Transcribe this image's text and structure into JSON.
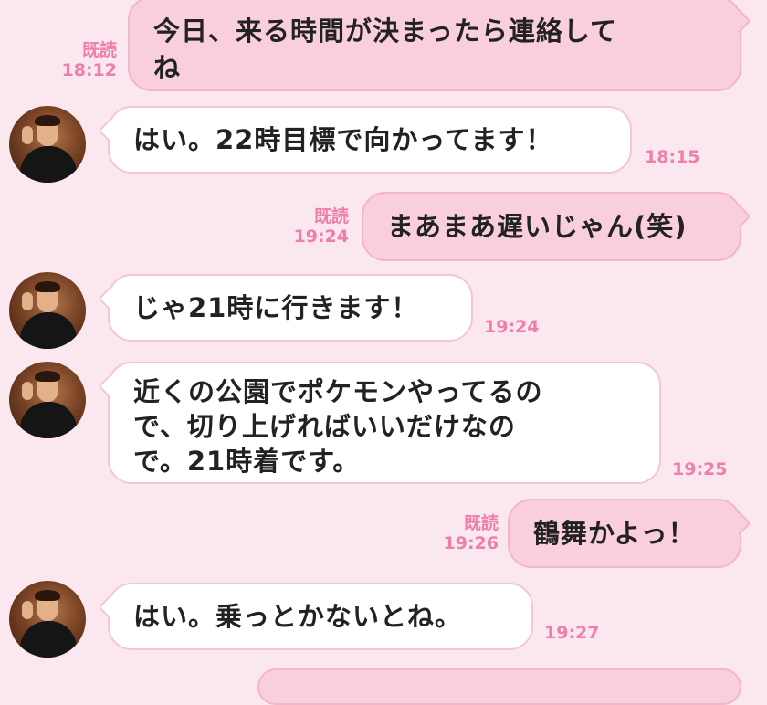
{
  "messages": [
    {
      "side": "out",
      "read_label": "既読",
      "time": "18:12",
      "text": "今日、来る時間が決まったら連絡して\nね"
    },
    {
      "side": "in",
      "time": "18:15",
      "text": "はい。22時目標で向かってます！"
    },
    {
      "side": "out",
      "read_label": "既読",
      "time": "19:24",
      "text": "まあまあ遅いじゃん(笑)"
    },
    {
      "side": "in",
      "time": "19:24",
      "text": "じゃ21時に行きます！"
    },
    {
      "side": "in",
      "time": "19:25",
      "text": "近くの公園でポケモンやってるの\nで、切り上げればいいだけなの\nで。21時着です。"
    },
    {
      "side": "out",
      "read_label": "既読",
      "time": "19:26",
      "text": "鶴舞かよっ！"
    },
    {
      "side": "in",
      "time": "19:27",
      "text": "はい。乗っとかないとね。"
    }
  ],
  "colors": {
    "background": "#fbe7ef",
    "meta": "#ee7fa7",
    "out_bubble": "#f9cfdc",
    "in_bubble": "#ffffff"
  }
}
